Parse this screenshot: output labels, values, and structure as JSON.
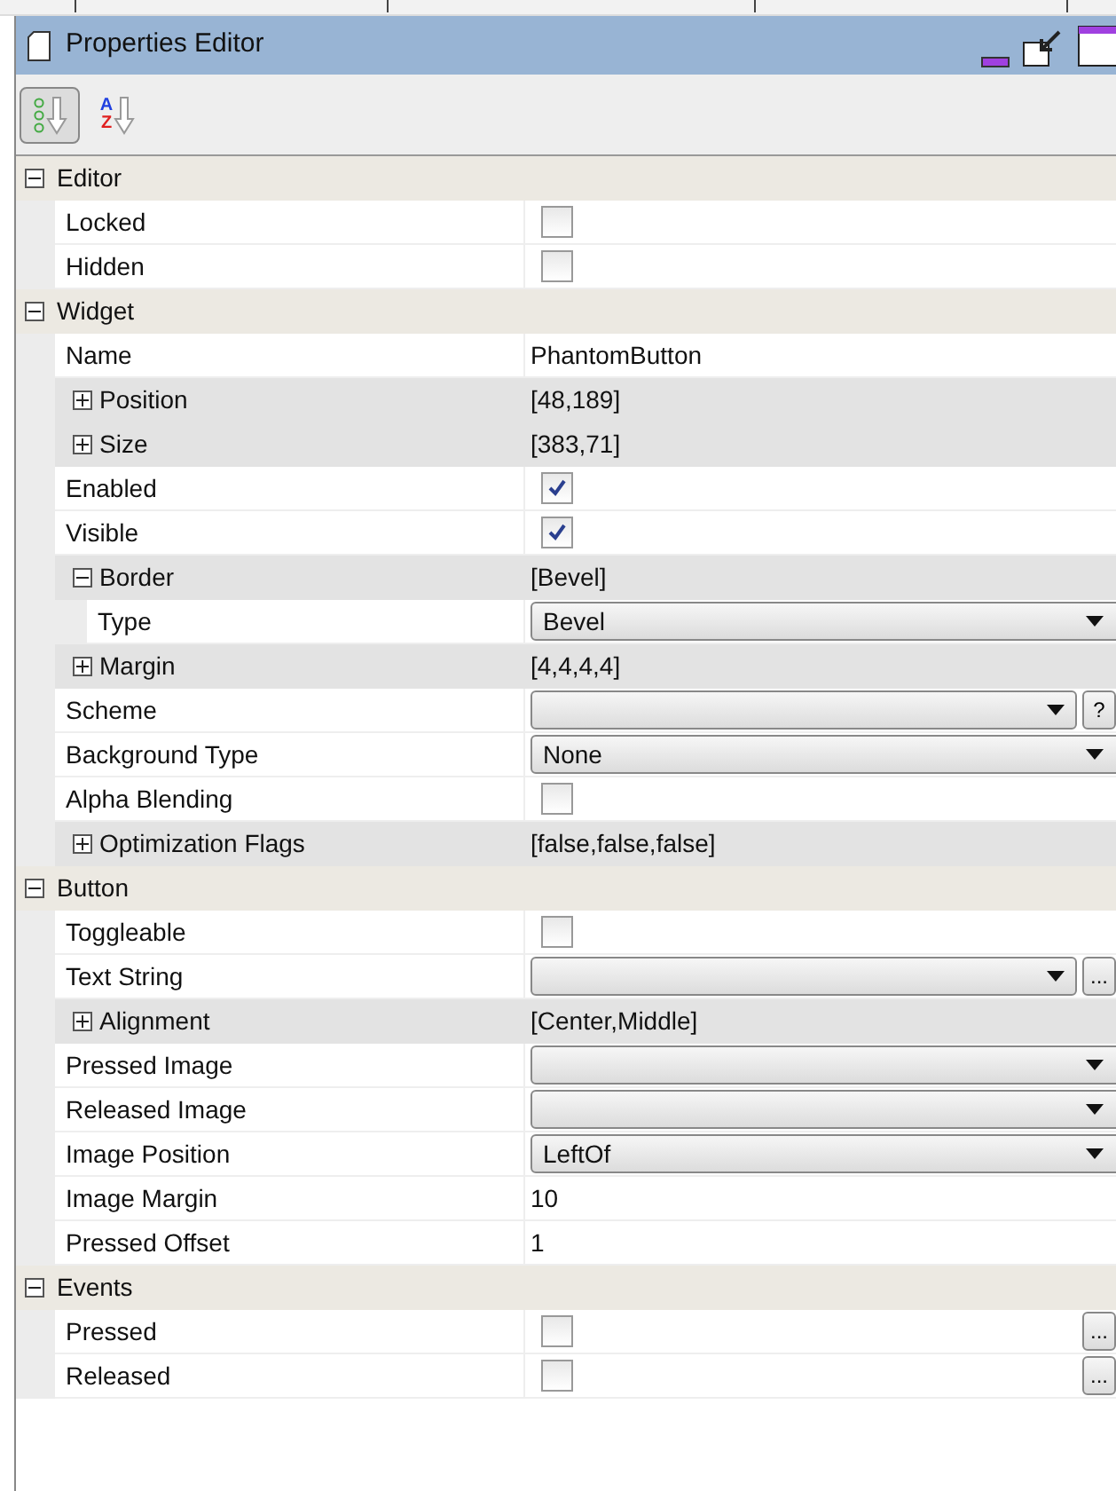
{
  "title": "Properties Editor",
  "toolbar": [
    {
      "kind": "categorized",
      "selected": true
    },
    {
      "kind": "alphabetical",
      "letters": [
        "A",
        "Z"
      ],
      "selected": false
    }
  ],
  "groups": [
    {
      "label": "Editor",
      "expanded": true,
      "properties": [
        {
          "name": "Locked",
          "kind": "checkbox",
          "checked": false
        },
        {
          "name": "Hidden",
          "kind": "checkbox",
          "checked": false
        }
      ]
    },
    {
      "label": "Widget",
      "expanded": true,
      "properties": [
        {
          "name": "Name",
          "kind": "text",
          "value": "PhantomButton"
        },
        {
          "name": "Position",
          "kind": "text",
          "value": "[48,189]",
          "expanded": false
        },
        {
          "name": "Size",
          "kind": "text",
          "value": "[383,71]",
          "expanded": false
        },
        {
          "name": "Enabled",
          "kind": "checkbox",
          "checked": true
        },
        {
          "name": "Visible",
          "kind": "checkbox",
          "checked": true
        },
        {
          "name": "Border",
          "kind": "text",
          "value": "[Bevel]",
          "expanded": true,
          "children": [
            {
              "name": "Type",
              "kind": "dropdown",
              "value": "Bevel"
            }
          ]
        },
        {
          "name": "Margin",
          "kind": "text",
          "value": "[4,4,4,4]",
          "expanded": false
        },
        {
          "name": "Scheme",
          "kind": "dropdown",
          "button": "?"
        },
        {
          "name": "Background Type",
          "kind": "dropdown",
          "value": "None"
        },
        {
          "name": "Alpha Blending",
          "kind": "checkbox",
          "checked": false
        },
        {
          "name": "Optimization Flags",
          "kind": "text",
          "value": "[false,false,false]",
          "expanded": false
        }
      ]
    },
    {
      "label": "Button",
      "expanded": true,
      "properties": [
        {
          "name": "Toggleable",
          "kind": "checkbox",
          "checked": false
        },
        {
          "name": "Text String",
          "kind": "dropdown",
          "button": "..."
        },
        {
          "name": "Alignment",
          "kind": "text",
          "value": "[Center,Middle]",
          "expanded": false
        },
        {
          "name": "Pressed Image",
          "kind": "dropdown"
        },
        {
          "name": "Released Image",
          "kind": "dropdown"
        },
        {
          "name": "Image Position",
          "kind": "dropdown",
          "value": "LeftOf"
        },
        {
          "name": "Image Margin",
          "kind": "text",
          "value": "10"
        },
        {
          "name": "Pressed Offset",
          "kind": "text",
          "value": "1"
        }
      ]
    },
    {
      "label": "Events",
      "expanded": true,
      "properties": [
        {
          "name": "Pressed",
          "kind": "checkbox",
          "checked": false,
          "button": "..."
        },
        {
          "name": "Released",
          "kind": "checkbox",
          "checked": false,
          "button": "..."
        }
      ]
    }
  ]
}
